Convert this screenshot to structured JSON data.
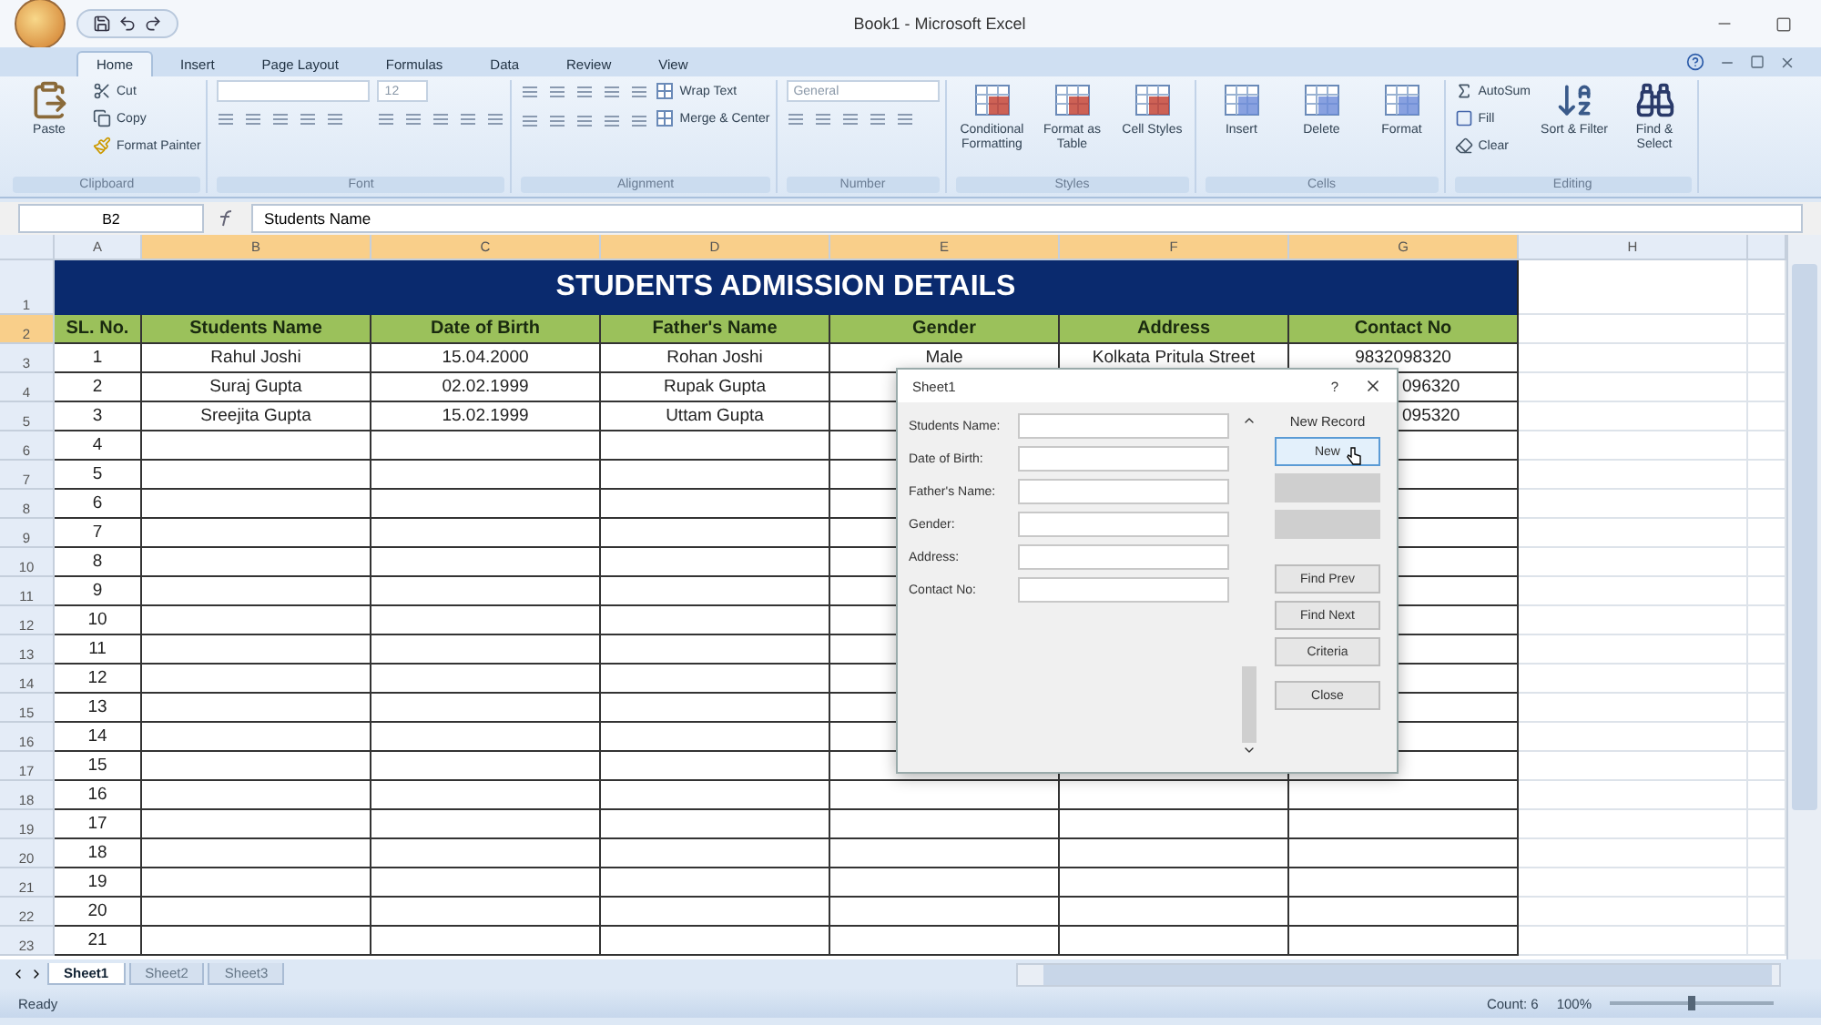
{
  "window": {
    "title": "Book1 - Microsoft Excel"
  },
  "ribbon_tabs": [
    {
      "label": "Home",
      "selected": true
    },
    {
      "label": "Insert",
      "selected": false
    },
    {
      "label": "Page Layout",
      "selected": false
    },
    {
      "label": "Formulas",
      "selected": false
    },
    {
      "label": "Data",
      "selected": false
    },
    {
      "label": "Review",
      "selected": false
    },
    {
      "label": "View",
      "selected": false
    }
  ],
  "ribbon_groups": [
    {
      "label": "Clipboard",
      "columns": [
        [
          {
            "kind": "big",
            "label": "Paste"
          }
        ],
        [
          {
            "kind": "small",
            "label": "Cut"
          },
          {
            "kind": "small",
            "label": "Copy"
          },
          {
            "kind": "small",
            "label": "Format Painter"
          }
        ]
      ]
    },
    {
      "label": "Font",
      "columns": [
        [
          {
            "kind": "field"
          },
          {
            "kind": "tools"
          }
        ],
        [
          {
            "kind": "field",
            "value": "12"
          },
          {
            "kind": "tools"
          }
        ]
      ]
    },
    {
      "label": "Alignment",
      "columns": [
        [
          {
            "kind": "tools"
          },
          {
            "kind": "tools"
          }
        ],
        [
          {
            "kind": "small",
            "label": "Wrap Text"
          },
          {
            "kind": "small",
            "label": "Merge & Center"
          }
        ]
      ]
    },
    {
      "label": "Number",
      "columns": [
        [
          {
            "kind": "field",
            "value": "General"
          },
          {
            "kind": "tools"
          }
        ]
      ]
    },
    {
      "label": "Styles",
      "columns": [
        [
          {
            "kind": "big",
            "label": "Conditional Formatting"
          }
        ],
        [
          {
            "kind": "big",
            "label": "Format as Table"
          }
        ],
        [
          {
            "kind": "big",
            "label": "Cell Styles"
          }
        ]
      ]
    },
    {
      "label": "Cells",
      "columns": [
        [
          {
            "kind": "big",
            "label": "Insert"
          }
        ],
        [
          {
            "kind": "big",
            "label": "Delete"
          }
        ],
        [
          {
            "kind": "big",
            "label": "Format"
          }
        ]
      ]
    },
    {
      "label": "Editing",
      "columns": [
        [
          {
            "kind": "small",
            "label": "AutoSum"
          },
          {
            "kind": "small",
            "label": "Fill"
          },
          {
            "kind": "small",
            "label": "Clear"
          }
        ],
        [
          {
            "kind": "big",
            "label": "Sort & Filter"
          }
        ],
        [
          {
            "kind": "big",
            "label": "Find & Select"
          }
        ]
      ]
    }
  ],
  "formula_bar": {
    "name_box": "B2",
    "formula": "Students Name"
  },
  "column_headers": [
    {
      "label": "A",
      "selected": false
    },
    {
      "label": "B",
      "selected": true
    },
    {
      "label": "C",
      "selected": true
    },
    {
      "label": "D",
      "selected": true
    },
    {
      "label": "E",
      "selected": true
    },
    {
      "label": "F",
      "selected": true
    },
    {
      "label": "G",
      "selected": true
    },
    {
      "label": "H",
      "selected": false
    }
  ],
  "title_row": {
    "num": "1",
    "selected": false,
    "text": "STUDENTS ADMISSION DETAILS"
  },
  "header_row": {
    "num": "2",
    "selected": true,
    "cells": [
      "SL. No.",
      "Students Name",
      "Date of Birth",
      "Father's Name",
      "Gender",
      "Address",
      "Contact No"
    ]
  },
  "rows": [
    {
      "num": "3",
      "selected": false,
      "cells": [
        {
          "text": "1"
        },
        {
          "text": "Rahul Joshi"
        },
        {
          "text": "15.04.2000"
        },
        {
          "text": "Rohan Joshi"
        },
        {
          "text": "Male"
        },
        {
          "text": "Kolkata Pritula Street"
        },
        {
          "text": "9832098320"
        }
      ]
    },
    {
      "num": "4",
      "selected": false,
      "cells": [
        {
          "text": "2"
        },
        {
          "text": "Suraj Gupta"
        },
        {
          "text": "02.02.1999"
        },
        {
          "text": "Rupak Gupta"
        },
        null,
        null,
        {
          "text": "096320",
          "cut": true
        }
      ]
    },
    {
      "num": "5",
      "selected": false,
      "cells": [
        {
          "text": "3"
        },
        {
          "text": "Sreejita Gupta"
        },
        {
          "text": "15.02.1999"
        },
        {
          "text": "Uttam Gupta"
        },
        null,
        null,
        {
          "text": "095320",
          "cut": true
        }
      ]
    },
    {
      "num": "6",
      "selected": false,
      "cells": [
        {
          "text": "4"
        }
      ]
    },
    {
      "num": "7",
      "selected": false,
      "cells": [
        {
          "text": "5"
        }
      ]
    },
    {
      "num": "8",
      "selected": false,
      "cells": [
        {
          "text": "6"
        }
      ]
    },
    {
      "num": "9",
      "selected": false,
      "cells": [
        {
          "text": "7"
        }
      ]
    },
    {
      "num": "10",
      "selected": false,
      "cells": [
        {
          "text": "8"
        }
      ]
    },
    {
      "num": "11",
      "selected": false,
      "cells": [
        {
          "text": "9"
        }
      ]
    },
    {
      "num": "12",
      "selected": false,
      "cells": [
        {
          "text": "10"
        }
      ]
    },
    {
      "num": "13",
      "selected": false,
      "cells": [
        {
          "text": "11"
        }
      ]
    },
    {
      "num": "14",
      "selected": false,
      "cells": [
        {
          "text": "12"
        }
      ]
    },
    {
      "num": "15",
      "selected": false,
      "cells": [
        {
          "text": "13"
        }
      ]
    },
    {
      "num": "16",
      "selected": false,
      "cells": [
        {
          "text": "14"
        }
      ]
    },
    {
      "num": "17",
      "selected": false,
      "cells": [
        {
          "text": "15"
        }
      ]
    },
    {
      "num": "18",
      "selected": false,
      "cells": [
        {
          "text": "16"
        }
      ]
    },
    {
      "num": "19",
      "selected": false,
      "cells": [
        {
          "text": "17"
        }
      ]
    },
    {
      "num": "20",
      "selected": false,
      "cells": [
        {
          "text": "18"
        }
      ]
    },
    {
      "num": "21",
      "selected": false,
      "cells": [
        {
          "text": "19"
        }
      ]
    },
    {
      "num": "22",
      "selected": false,
      "cells": [
        {
          "text": "20"
        }
      ]
    },
    {
      "num": "23",
      "selected": false,
      "cells": [
        {
          "text": "21"
        }
      ]
    }
  ],
  "dialog": {
    "title": "Sheet1",
    "help": "?",
    "status": "New Record",
    "fields": [
      {
        "label": "Students Name:"
      },
      {
        "label": "Date of Birth:"
      },
      {
        "label": "Father's Name:"
      },
      {
        "label": "Gender:"
      },
      {
        "label": "Address:"
      },
      {
        "label": "Contact No:"
      }
    ],
    "buttons": [
      {
        "label": "New",
        "highlighted": true,
        "disabled": false
      },
      {
        "disabled": true,
        "highlighted": false
      },
      {
        "disabled": true,
        "highlighted": false
      },
      {
        "label": "Find Prev",
        "highlighted": false,
        "disabled": false
      },
      {
        "label": "Find Next",
        "highlighted": false,
        "disabled": false
      },
      {
        "label": "Criteria",
        "highlighted": false,
        "disabled": false
      },
      {
        "label": "Close",
        "highlighted": false,
        "disabled": false
      }
    ]
  },
  "sheet_tabs": [
    {
      "label": "Sheet1",
      "selected": true
    },
    {
      "label": "Sheet2",
      "selected": false
    },
    {
      "label": "Sheet3",
      "selected": false
    }
  ],
  "status_bar": {
    "mode": "Ready",
    "count": "Count: 6",
    "zoom": "100%",
    "zoom_slider": {
      "level": 0.5
    }
  }
}
